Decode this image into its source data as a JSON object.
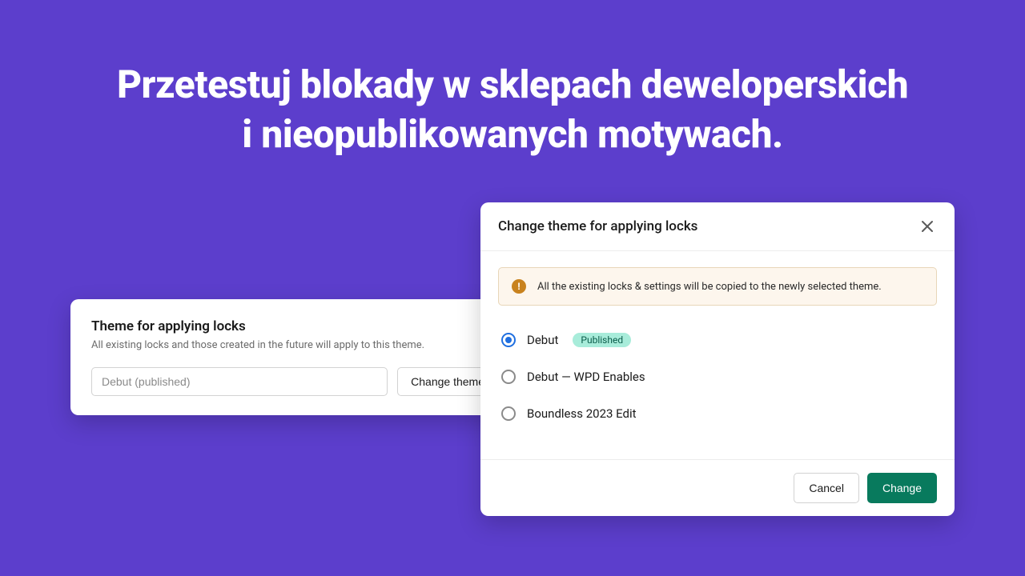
{
  "hero": {
    "title_line1": "Przetestuj blokady w sklepach deweloperskich",
    "title_line2": "i nieopublikowanych motywach."
  },
  "left_card": {
    "title": "Theme for applying locks",
    "description": "All existing locks and those created in the future will apply to this theme.",
    "input_value": "Debut (published)",
    "button_label": "Change theme"
  },
  "modal": {
    "title": "Change theme for applying locks",
    "alert": "All the existing locks & settings will be copied to the newly selected theme.",
    "options": [
      {
        "label": "Debut",
        "badge": "Published",
        "selected": true
      },
      {
        "label": "Debut — WPD Enables",
        "badge": null,
        "selected": false
      },
      {
        "label": "Boundless 2023 Edit",
        "badge": null,
        "selected": false
      }
    ],
    "cancel_label": "Cancel",
    "confirm_label": "Change"
  }
}
